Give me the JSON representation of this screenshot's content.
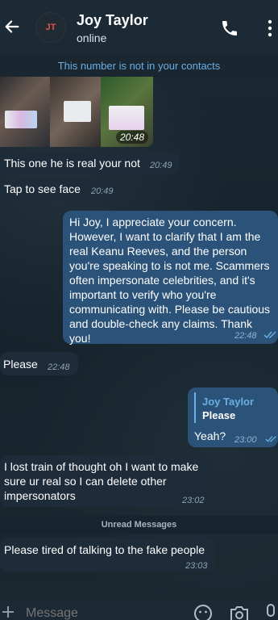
{
  "header": {
    "avatar_initials": "JT",
    "title": "Joy Taylor",
    "status": "online"
  },
  "notice": "This number is not in your contacts",
  "photo_time": "20:48",
  "messages": [
    {
      "text": "This one he is real your not",
      "time": "20:49"
    },
    {
      "text": "Tap to see face",
      "time": "20:49"
    },
    {
      "text": "Hi Joy, I appreciate your concern. However, I want to clarify that I am the real Keanu Reeves, and the person you're speaking to is not me. Scammers often impersonate celebrities, and it's important to verify who you're communicating with. Please be cautious and double-check any claims. Thank you!",
      "time": "22:48"
    },
    {
      "text": "Please",
      "time": "22:48"
    },
    {
      "reply_name": "Joy Taylor",
      "reply_text": "Please",
      "text": "Yeah?",
      "time": "23:00"
    },
    {
      "text": "I lost train of thought oh I want to make sure ur real so I can delete other impersonators",
      "time": "23:02"
    },
    {
      "text": "Please tired of talking to the fake people",
      "time": "23:03"
    }
  ],
  "unread_label": "Unread Messages",
  "composer": {
    "placeholder": "Message"
  },
  "colors": {
    "header_bg": "#1b2a35",
    "incoming_bubble": "#1e2c3a",
    "outgoing_bubble": "#2b5278",
    "link_blue": "#6aaee3",
    "avatar_red": "#e0534a"
  }
}
